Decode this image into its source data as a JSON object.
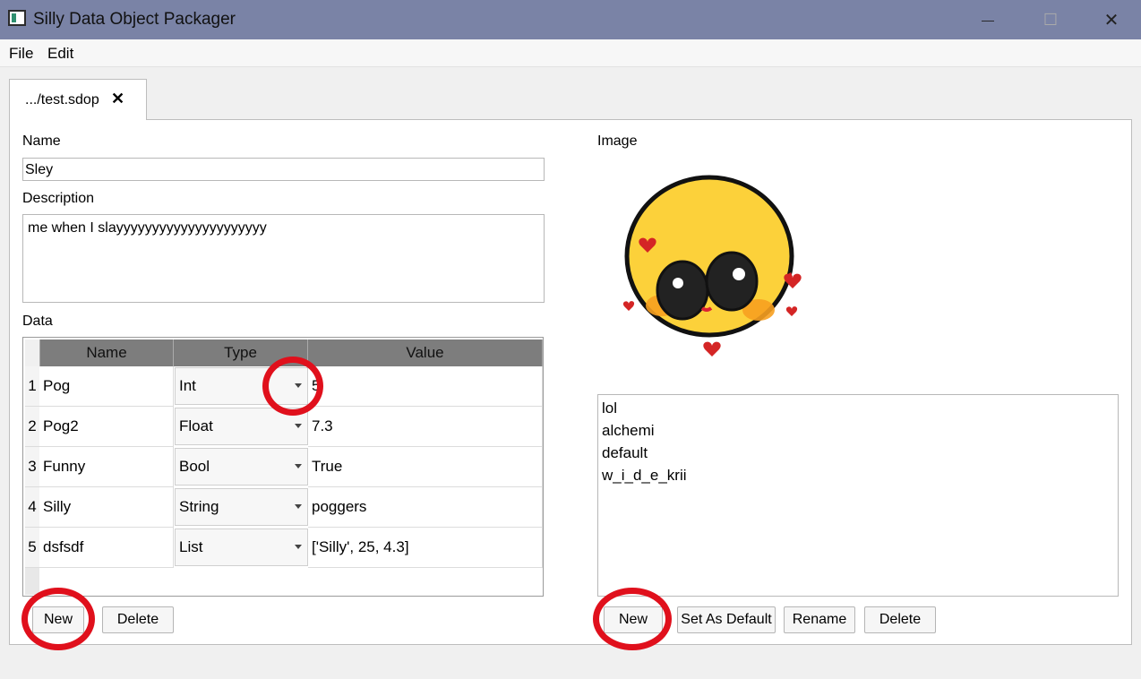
{
  "window": {
    "title": "Silly Data Object Packager",
    "minimize_glyph": "—",
    "maximize_glyph": "☐",
    "close_glyph": "✕"
  },
  "menu": [
    "File",
    "Edit"
  ],
  "tab": {
    "label": ".../test.sdop",
    "close_glyph": "✕"
  },
  "form": {
    "name_label": "Name",
    "name_value": "Sley",
    "description_label": "Description",
    "description_value": "me when I slayyyyyyyyyyyyyyyyyyyyy",
    "data_label": "Data"
  },
  "table": {
    "headers": [
      "Name",
      "Type",
      "Value"
    ],
    "rows": [
      {
        "num": "1",
        "name": "Pog",
        "type": "Int",
        "value": "5"
      },
      {
        "num": "2",
        "name": "Pog2",
        "type": "Float",
        "value": "7.3"
      },
      {
        "num": "3",
        "name": "Funny",
        "type": "Bool",
        "value": "True"
      },
      {
        "num": "4",
        "name": "Silly",
        "type": "String",
        "value": "poggers"
      },
      {
        "num": "5",
        "name": "dsfsdf",
        "type": "List",
        "value": "['Silly', 25, 4.3]"
      }
    ]
  },
  "data_buttons": {
    "new": "New",
    "delete": "Delete"
  },
  "image_section": {
    "label": "Image",
    "image_icon": "blushing-emoji-icon",
    "images": [
      "lol",
      "alchemi",
      "default",
      "w_i_d_e_krii"
    ],
    "buttons": {
      "new": "New",
      "set_default": "Set As Default",
      "rename": "Rename",
      "delete": "Delete"
    }
  },
  "colors": {
    "titlebar": "#7a83a6",
    "highlight_ring": "#e0101c",
    "table_header": "#7d7d7d"
  }
}
